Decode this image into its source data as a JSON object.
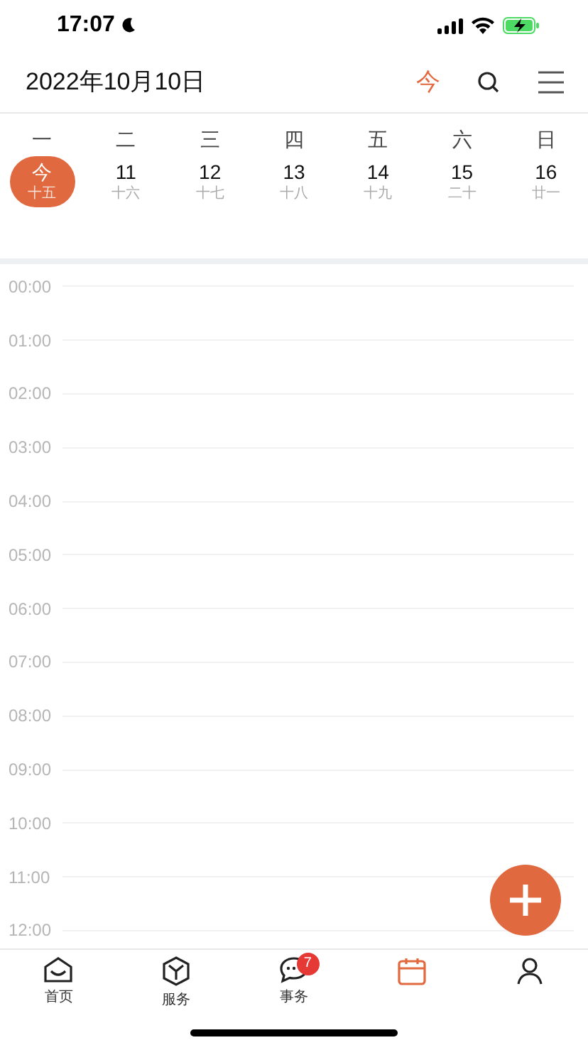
{
  "status_bar": {
    "time": "17:07"
  },
  "header": {
    "title": "2022年10月10日",
    "today_button": "今"
  },
  "week": {
    "weekdays": [
      "一",
      "二",
      "三",
      "四",
      "五",
      "六",
      "日"
    ],
    "days": [
      {
        "day": "今",
        "lunar": "十五",
        "selected": true
      },
      {
        "day": "11",
        "lunar": "十六",
        "selected": false
      },
      {
        "day": "12",
        "lunar": "十七",
        "selected": false
      },
      {
        "day": "13",
        "lunar": "十八",
        "selected": false
      },
      {
        "day": "14",
        "lunar": "十九",
        "selected": false
      },
      {
        "day": "15",
        "lunar": "二十",
        "selected": false
      },
      {
        "day": "16",
        "lunar": "廿一",
        "selected": false
      }
    ]
  },
  "timeline": [
    "00:00",
    "01:00",
    "02:00",
    "03:00",
    "04:00",
    "05:00",
    "06:00",
    "07:00",
    "08:00",
    "09:00",
    "10:00",
    "11:00",
    "12:00"
  ],
  "tab_bar": [
    {
      "kind": "home",
      "label": "首页",
      "selected": false
    },
    {
      "kind": "service",
      "label": "服务",
      "selected": false
    },
    {
      "kind": "chat",
      "label": "事务",
      "badge": "7",
      "selected": false
    },
    {
      "kind": "calendar",
      "selected": true
    },
    {
      "kind": "profile",
      "selected": false
    }
  ]
}
